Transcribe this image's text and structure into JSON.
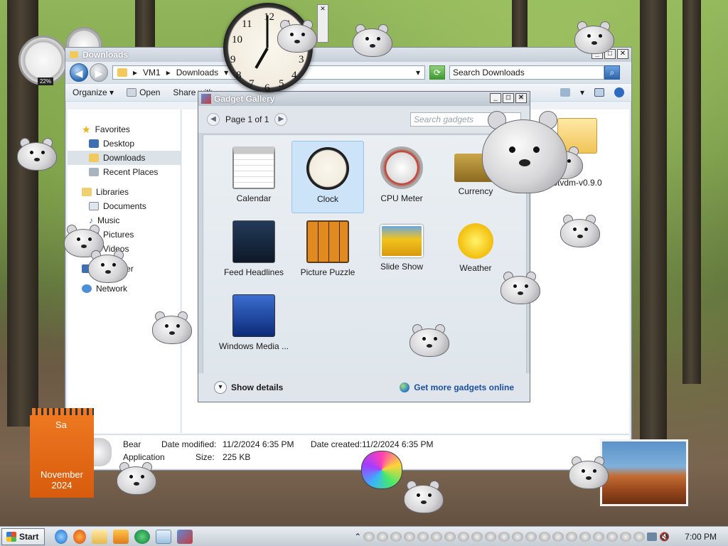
{
  "explorer": {
    "title": "Downloads",
    "breadcrumb": [
      "VM1",
      "Downloads"
    ],
    "search_placeholder": "Search Downloads",
    "toolbar": {
      "organize": "Organize",
      "open": "Open",
      "share": "Share with"
    },
    "nav": {
      "favorites": "Favorites",
      "desktop": "Desktop",
      "downloads": "Downloads",
      "recent": "Recent Places",
      "libraries": "Libraries",
      "documents": "Documents",
      "music": "Music",
      "pictures": "Pictures",
      "videos": "Videos",
      "computer": "Computer",
      "network": "Network"
    },
    "file_name": "btvdm-v0.9.0",
    "details": {
      "name": "Bear",
      "type": "Application",
      "modified_label": "Date modified:",
      "modified": "11/2/2024 6:35 PM",
      "created_label": "Date created:",
      "created": "11/2/2024 6:35 PM",
      "size_label": "Size:",
      "size": "225 KB"
    }
  },
  "gallery": {
    "title": "Gadget Gallery",
    "page": "Page 1 of 1",
    "search_placeholder": "Search gadgets",
    "gadgets": [
      {
        "label": "Calendar"
      },
      {
        "label": "Clock"
      },
      {
        "label": "CPU Meter"
      },
      {
        "label": "Currency"
      },
      {
        "label": "Feed Headlines"
      },
      {
        "label": "Picture Puzzle"
      },
      {
        "label": "Slide Show"
      },
      {
        "label": "Weather"
      },
      {
        "label": "Windows Media ..."
      }
    ],
    "selected": "Clock",
    "show_details": "Show details",
    "get_more": "Get more gadgets online"
  },
  "desktop": {
    "cpu_percent": "22%",
    "clock_time": "7:00",
    "calendar_month": "November 2024",
    "calendar_day_prefix": "Sa"
  },
  "taskbar": {
    "start": "Start",
    "time": "7:00 PM"
  },
  "colors": {
    "accent_blue": "#1b4f9e",
    "calendar_orange": "#e8681a",
    "selection": "#cde3f7"
  }
}
